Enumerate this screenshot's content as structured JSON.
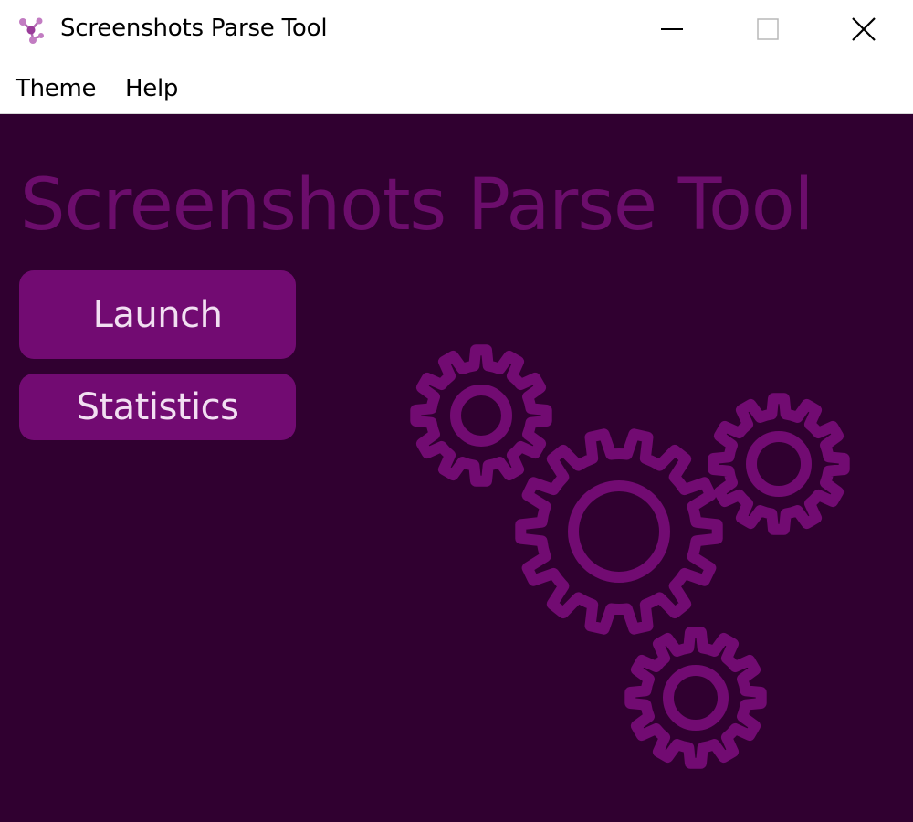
{
  "window": {
    "title": "Screenshots Parse Tool",
    "icon": "app-molecule-icon",
    "controls": {
      "minimize_icon": "minimize-icon",
      "maximize_icon": "maximize-icon",
      "close_icon": "close-icon"
    }
  },
  "menu": {
    "items": [
      {
        "label": "Theme"
      },
      {
        "label": "Help"
      }
    ]
  },
  "main": {
    "heading": "Screenshots Parse Tool",
    "buttons": [
      {
        "label": "Launch"
      },
      {
        "label": "Statistics"
      }
    ],
    "illustration": "gears-icon"
  },
  "colors": {
    "background": "#300030",
    "accent": "#720b72",
    "heading": "#6c0d6c",
    "button_text": "#f2dff2"
  }
}
